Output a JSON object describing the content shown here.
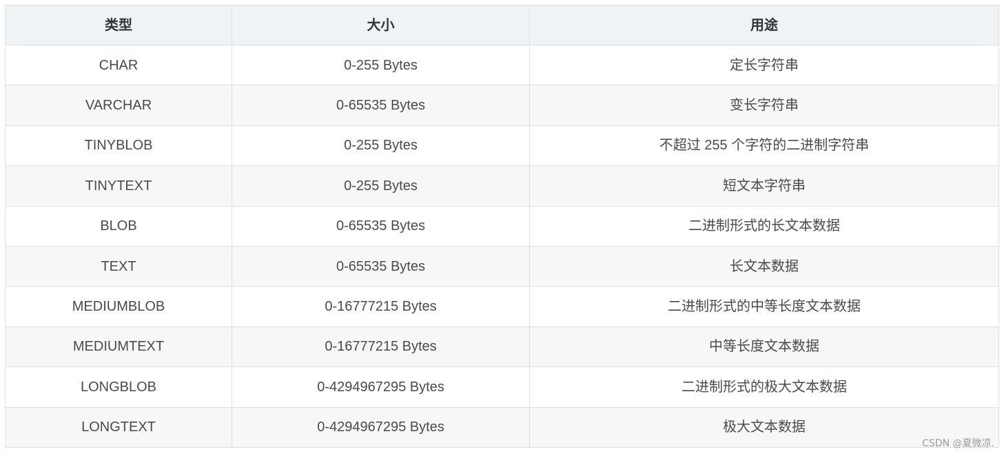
{
  "table": {
    "headers": [
      "类型",
      "大小",
      "用途"
    ],
    "rows": [
      [
        "CHAR",
        "0-255 Bytes",
        "定长字符串"
      ],
      [
        "VARCHAR",
        "0-65535 Bytes",
        "变长字符串"
      ],
      [
        "TINYBLOB",
        "0-255 Bytes",
        "不超过 255 个字符的二进制字符串"
      ],
      [
        "TINYTEXT",
        "0-255 Bytes",
        "短文本字符串"
      ],
      [
        "BLOB",
        "0-65535 Bytes",
        "二进制形式的长文本数据"
      ],
      [
        "TEXT",
        "0-65535 Bytes",
        "长文本数据"
      ],
      [
        "MEDIUMBLOB",
        "0-16777215 Bytes",
        "二进制形式的中等长度文本数据"
      ],
      [
        "MEDIUMTEXT",
        "0-16777215 Bytes",
        "中等长度文本数据"
      ],
      [
        "LONGBLOB",
        "0-4294967295 Bytes",
        "二进制形式的极大文本数据"
      ],
      [
        "LONGTEXT",
        "0-4294967295 Bytes",
        "极大文本数据"
      ]
    ]
  },
  "watermark": "CSDN @夏微凉."
}
